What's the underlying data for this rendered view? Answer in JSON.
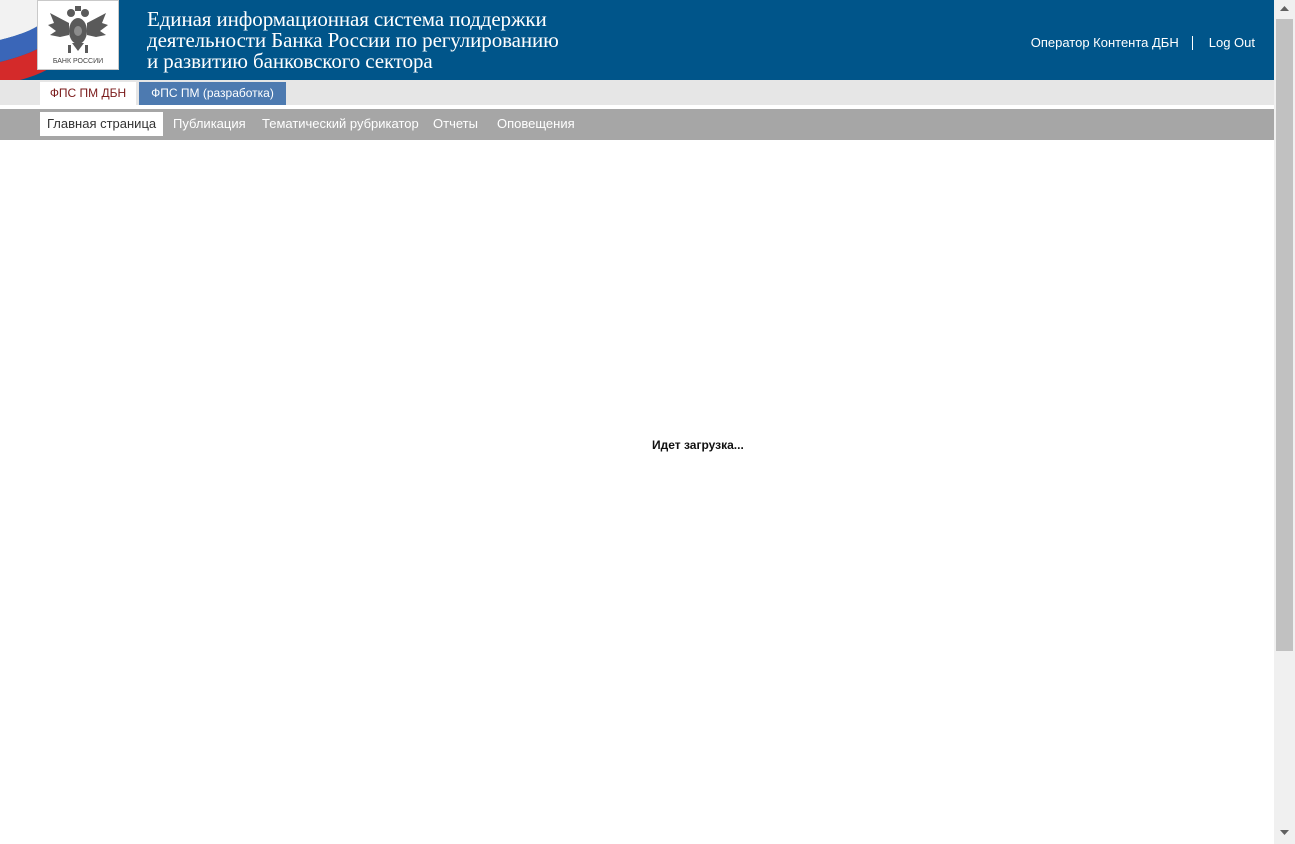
{
  "header": {
    "title_lines": [
      "Единая информационная система поддержки",
      "деятельности Банка России по регулированию",
      "и развитию банковского сектора"
    ],
    "logo_text": "БАНК РОССИИ",
    "user_name": "Оператор Контента ДБН",
    "logout_label": "Log Out"
  },
  "tabs": [
    {
      "label": "ФПС ПМ ДБН",
      "active": true
    },
    {
      "label": "ФПС ПМ (разработка)",
      "active": false
    }
  ],
  "nav": {
    "items": [
      {
        "label": "Главная страница",
        "active": true
      },
      {
        "label": "Публикация",
        "active": false
      },
      {
        "label": "Тематический рубрикатор",
        "active": false
      },
      {
        "label": "Отчеты",
        "active": false
      },
      {
        "label": "Оповещения",
        "active": false
      }
    ]
  },
  "main": {
    "loading_text": "Идет загрузка..."
  },
  "colors": {
    "header_bg": "#00558a",
    "tabs_bg": "#e6e6e6",
    "active_tab_text": "#7a1a1a",
    "dev_tab_bg": "#4d7ab0",
    "nav_bg": "#a6a6a6"
  }
}
